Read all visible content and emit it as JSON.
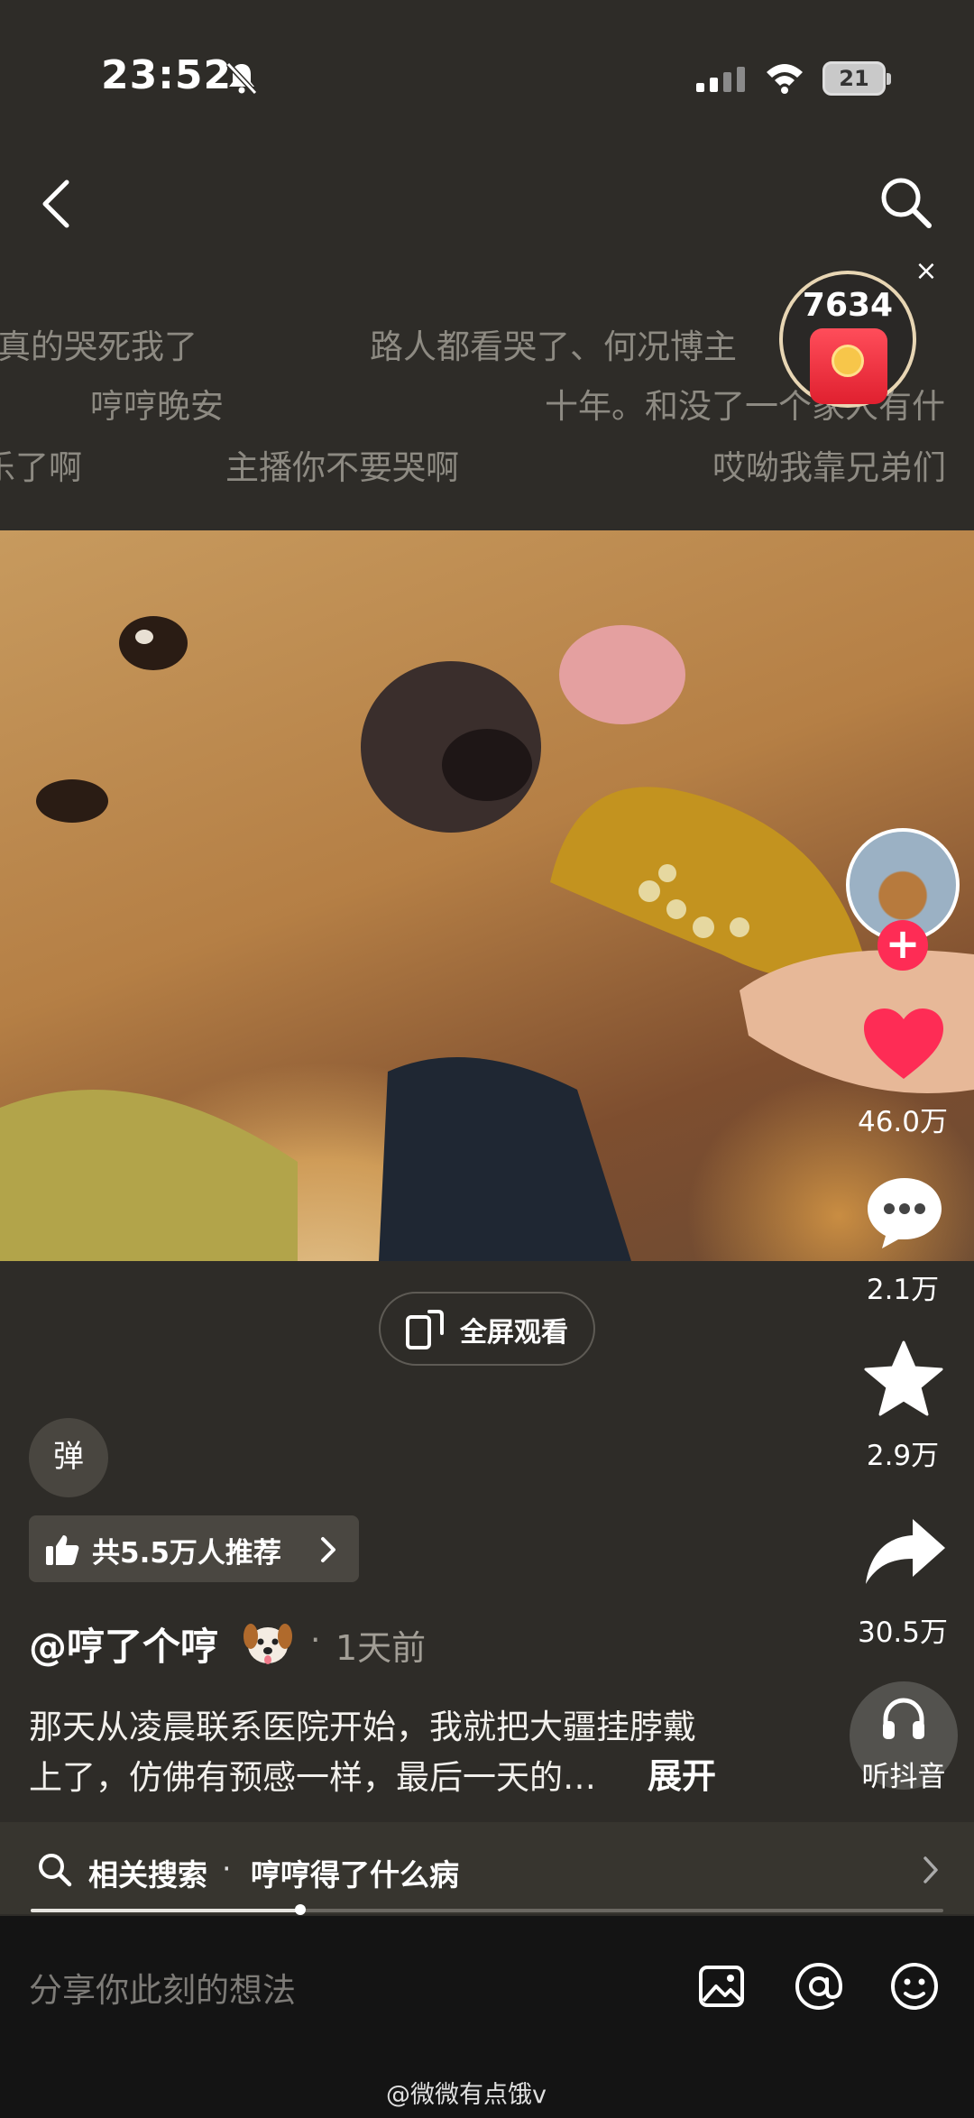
{
  "status_bar": {
    "time": "23:52",
    "battery": "21"
  },
  "danmaku": [
    "我真的哭死我了",
    "路人都看哭了、何况博主",
    "哼哼晚安",
    "十年。和没了一个家人有什",
    "乐了啊",
    "主播你不要哭啊",
    "哎呦我靠兄弟们"
  ],
  "red_packet": {
    "count": "7634",
    "close": "×"
  },
  "video": {
    "fullscreen_label": "全屏观看"
  },
  "actions": {
    "likes": "46.0万",
    "comments": "2.1万",
    "favorites": "2.9万",
    "shares": "30.5万",
    "listen": "听抖音"
  },
  "danmaku_toggle": "弹",
  "recommend": {
    "label": "共5.5万人推荐"
  },
  "author": {
    "name": "@哼了个哼",
    "separator": "·",
    "time": "1天前"
  },
  "description": {
    "line1": "那天从凌晨联系医院开始，我就把大疆挂脖戴",
    "line2": "上了，仿佛有预感一样，最后一天的…",
    "more": "展开"
  },
  "related_search": {
    "prefix": "相关搜索",
    "separator": "·",
    "query": "哼哼得了什么病"
  },
  "playback": {
    "progress": 0.295
  },
  "comment_bar": {
    "placeholder": "分享你此刻的想法"
  },
  "watermark": "@微微有点饿v",
  "icons": [
    "bell-off-icon",
    "signal-icon",
    "wifi-icon",
    "back-icon",
    "search-icon",
    "heart-icon",
    "comment-icon",
    "star-icon",
    "share-icon",
    "headphones-icon",
    "fullscreen-icon",
    "thumbs-up-icon",
    "chevron-right-icon",
    "image-icon",
    "at-icon",
    "emoji-icon"
  ],
  "colors": {
    "background": "#2e2c28",
    "accent": "#fe2c55",
    "bottom_bar": "#141414"
  }
}
